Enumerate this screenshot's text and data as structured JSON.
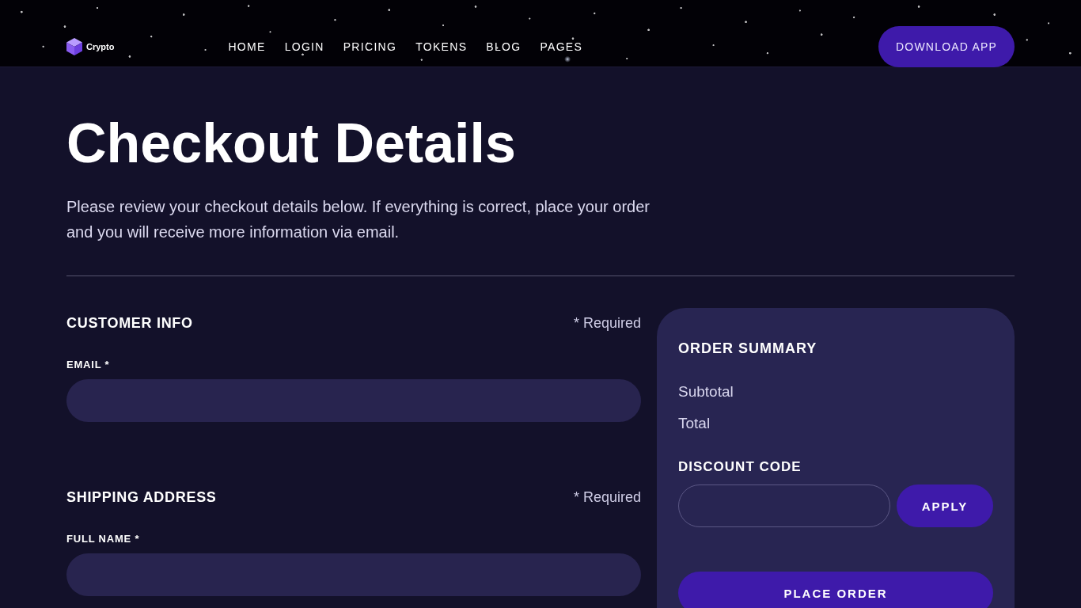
{
  "header": {
    "logo": "Crypto",
    "nav": [
      {
        "label": "HOME"
      },
      {
        "label": "LOGIN"
      },
      {
        "label": "PRICING"
      },
      {
        "label": "TOKENS"
      },
      {
        "label": "BLOG"
      },
      {
        "label": "PAGES"
      }
    ],
    "cta": "DOWNLOAD APP"
  },
  "page": {
    "title": "Checkout Details",
    "intro": "Please review your checkout details below. If everything is correct, place your order and you will receive more information via email."
  },
  "sections": [
    {
      "title": "CUSTOMER INFO",
      "note": "* Required",
      "fields": [
        {
          "label": "EMAIL *"
        }
      ]
    },
    {
      "title": "SHIPPING ADDRESS",
      "note": "* Required",
      "fields": [
        {
          "label": "FULL NAME *"
        }
      ]
    }
  ],
  "order_summary": {
    "title": "ORDER SUMMARY",
    "lines": [
      {
        "label": "Subtotal"
      },
      {
        "label": "Total"
      }
    ],
    "discount": {
      "label": "DISCOUNT CODE",
      "button": "APPLY"
    },
    "submit": "PLACE ORDER"
  }
}
